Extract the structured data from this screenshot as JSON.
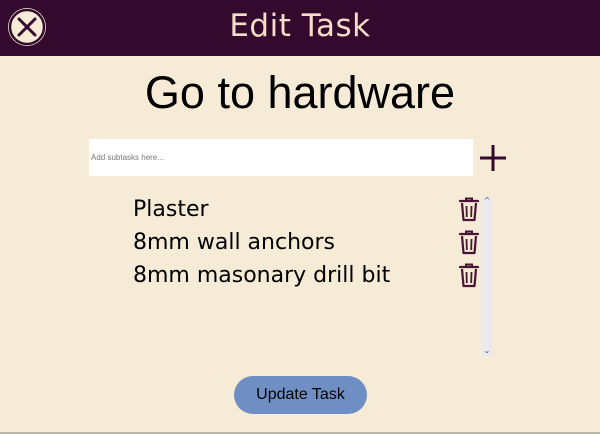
{
  "header": {
    "title": "Edit Task",
    "close_icon": "close-icon",
    "background": "#330a2e",
    "title_color": "#f7dcc8"
  },
  "task": {
    "title": "Go to hardware"
  },
  "subtask_input": {
    "placeholder": "Add subtasks here...",
    "value": ""
  },
  "add_button": {
    "icon": "plus-icon"
  },
  "subtasks": [
    {
      "label": "Plaster",
      "delete_icon": "trash-icon"
    },
    {
      "label": "8mm wall anchors",
      "delete_icon": "trash-icon"
    },
    {
      "label": "8mm masonary drill bit",
      "delete_icon": "trash-icon"
    }
  ],
  "scrollbar": {
    "up_icon": "chevron-up-icon",
    "down_icon": "chevron-down-icon"
  },
  "update_button": {
    "label": "Update Task",
    "color": "#6f8fc4"
  },
  "colors": {
    "background": "#f5ebd7",
    "accent": "#330a2e"
  }
}
